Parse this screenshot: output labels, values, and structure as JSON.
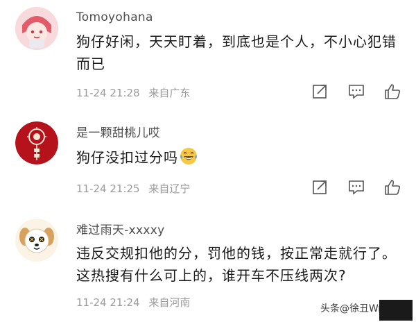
{
  "comments": [
    {
      "username": "Tomoyohana",
      "text": "狗仔好闲，天天盯着，到底也是个人，不小心犯错而已",
      "time": "11-24 21:28",
      "location": "来自广东"
    },
    {
      "username": "是一颗甜桃儿哎",
      "text": "狗仔没扣过分吗",
      "emoji": "laughing-tears-emoji",
      "time": "11-24 21:25",
      "location": "来自辽宁"
    },
    {
      "username": "难过雨天-xxxxy",
      "text": "违反交规扣他的分，罚他的钱，按正常走就行了。这热搜有什么可上的，谁开车不压线两次?",
      "time": "11-24 21:24",
      "location": "来自河南"
    }
  ],
  "icons": [
    "share-icon",
    "reply-icon",
    "like-icon"
  ],
  "watermark": "头条@徐丑Wr战",
  "colors": {
    "text": "#1a1a1a",
    "meta": "#9a9a9a",
    "username": "#4d4d4d",
    "avatar_red": "#b5121b"
  }
}
